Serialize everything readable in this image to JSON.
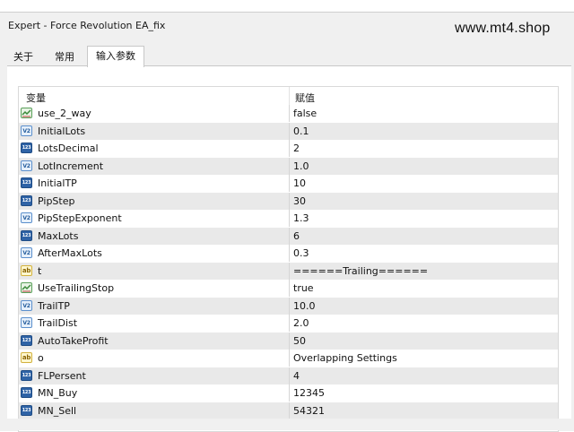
{
  "window": {
    "title": "Expert - Force Revolution EA_fix"
  },
  "watermark": "www.mt4.shop",
  "tabs": [
    {
      "label": "关于",
      "active": false
    },
    {
      "label": "常用",
      "active": false
    },
    {
      "label": "输入参数",
      "active": true
    }
  ],
  "grid": {
    "headers": {
      "variable": "变量",
      "value": "赋值"
    },
    "rows": [
      {
        "type": "bool",
        "icon_text": "",
        "name": "use_2_way",
        "value": "false"
      },
      {
        "type": "double",
        "icon_text": "V2",
        "name": "InitialLots",
        "value": "0.1"
      },
      {
        "type": "int",
        "icon_text": "123",
        "name": "LotsDecimal",
        "value": "2"
      },
      {
        "type": "double",
        "icon_text": "V2",
        "name": "LotIncrement",
        "value": "1.0"
      },
      {
        "type": "int",
        "icon_text": "123",
        "name": "InitialTP",
        "value": "10"
      },
      {
        "type": "int",
        "icon_text": "123",
        "name": "PipStep",
        "value": "30"
      },
      {
        "type": "double",
        "icon_text": "V2",
        "name": "PipStepExponent",
        "value": "1.3"
      },
      {
        "type": "int",
        "icon_text": "123",
        "name": "MaxLots",
        "value": "6"
      },
      {
        "type": "double",
        "icon_text": "V2",
        "name": "AfterMaxLots",
        "value": "0.3"
      },
      {
        "type": "string",
        "icon_text": "ab",
        "name": "t",
        "value": "======Trailing======"
      },
      {
        "type": "bool",
        "icon_text": "",
        "name": "UseTrailingStop",
        "value": "true"
      },
      {
        "type": "double",
        "icon_text": "V2",
        "name": "TrailTP",
        "value": "10.0"
      },
      {
        "type": "double",
        "icon_text": "V2",
        "name": "TrailDist",
        "value": "2.0"
      },
      {
        "type": "int",
        "icon_text": "123",
        "name": "AutoTakeProfit",
        "value": "50"
      },
      {
        "type": "string",
        "icon_text": "ab",
        "name": "o",
        "value": "Overlapping Settings"
      },
      {
        "type": "int",
        "icon_text": "123",
        "name": "FLPersent",
        "value": "4"
      },
      {
        "type": "int",
        "icon_text": "123",
        "name": "MN_Buy",
        "value": "12345"
      },
      {
        "type": "int",
        "icon_text": "123",
        "name": "MN_Sell",
        "value": "54321"
      }
    ]
  }
}
